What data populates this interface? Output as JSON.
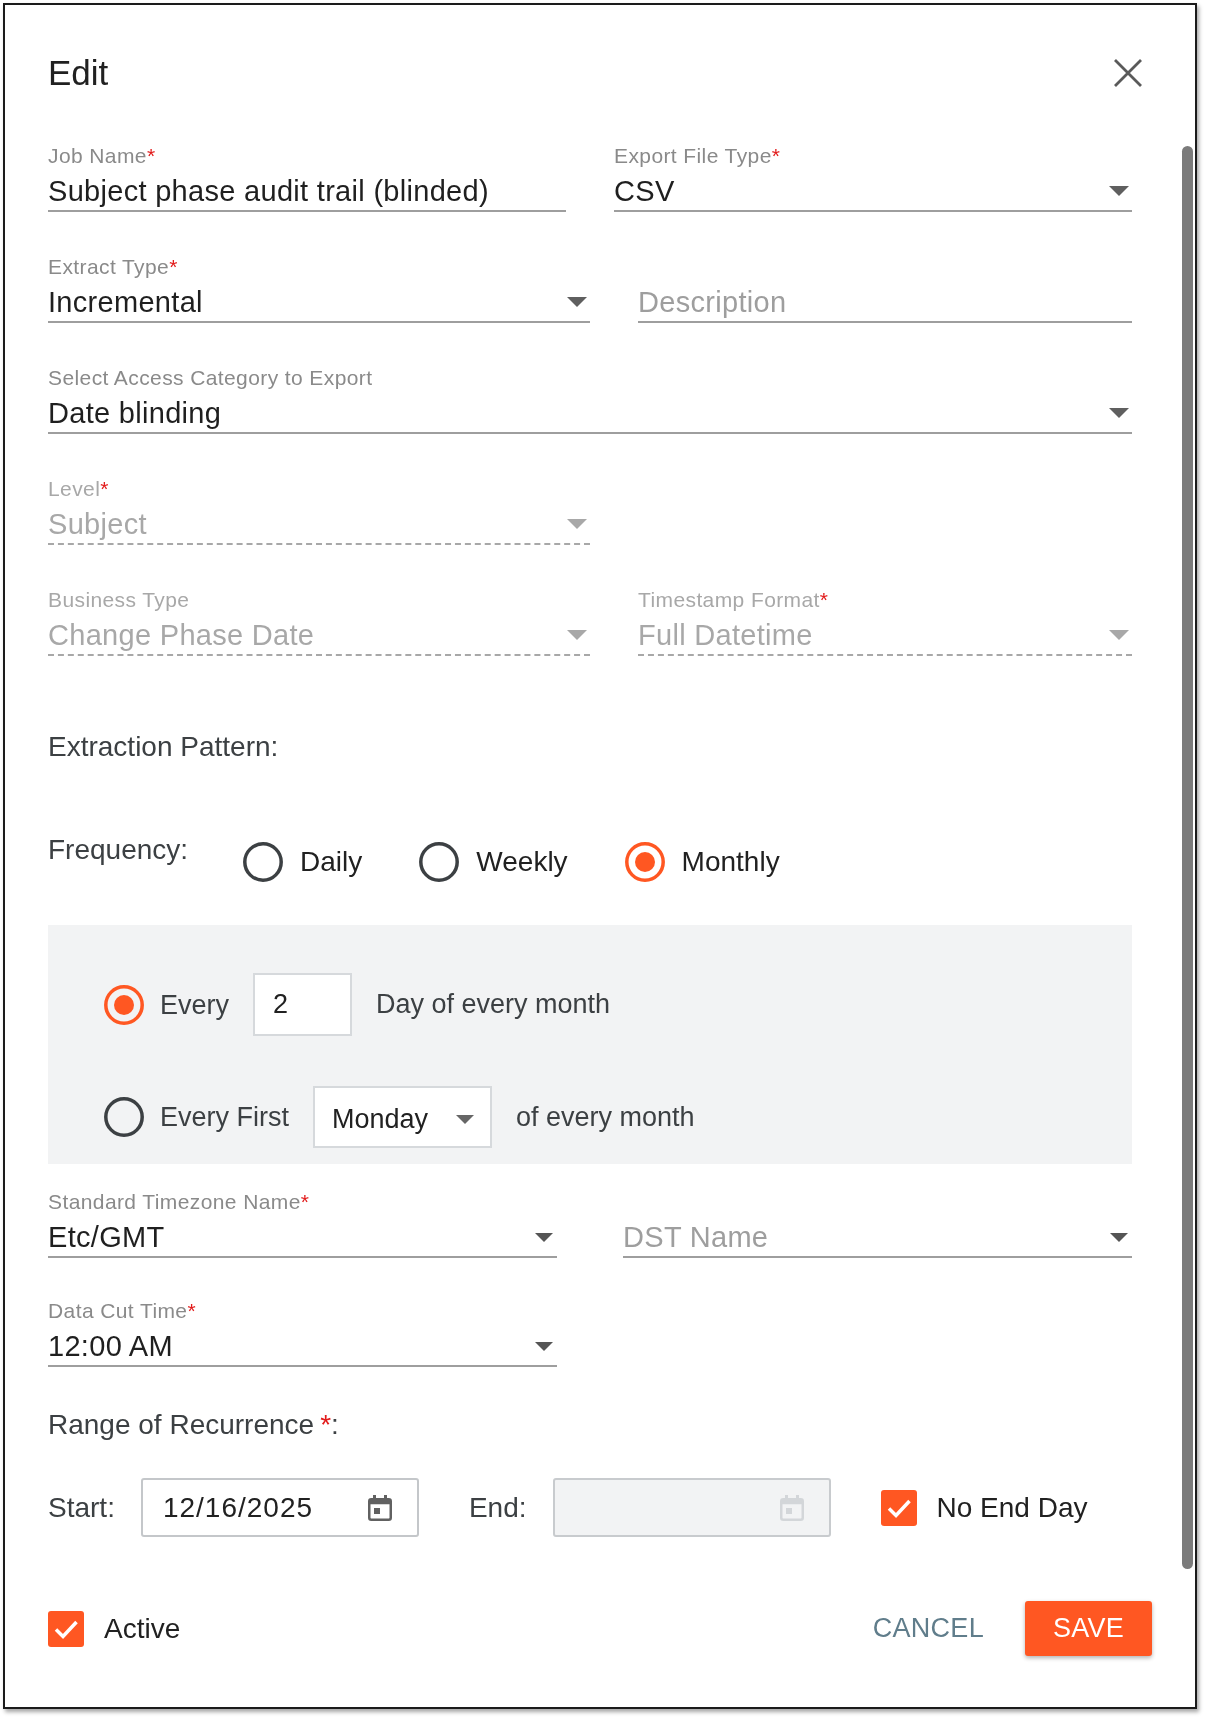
{
  "dialog": {
    "title": "Edit"
  },
  "field_rows": [
    [
      {
        "kind": "text",
        "label": "Job Name",
        "required_mark": "*",
        "value": "Subject phase audit trail (blinded)",
        "disabled": false
      },
      {
        "kind": "select",
        "label": "Export File Type",
        "required_mark": "*",
        "value": "CSV",
        "disabled": false
      }
    ],
    [
      {
        "kind": "select",
        "label": "Extract Type",
        "required_mark": "*",
        "value": "Incremental",
        "disabled": false
      },
      {
        "kind": "text",
        "placeholder": "Description",
        "disabled": false
      }
    ],
    [
      {
        "kind": "select",
        "label": "Select Access Category to Export",
        "value": "Date blinding",
        "disabled": false
      }
    ],
    [
      {
        "kind": "select",
        "label": "Level",
        "required_mark": "*",
        "value": "Subject",
        "disabled": true
      }
    ],
    [
      {
        "kind": "select",
        "label": "Business Type",
        "value": "Change Phase Date",
        "disabled": true
      },
      {
        "kind": "select",
        "label": "Timestamp Format",
        "required_mark": "*",
        "value": "Full Datetime",
        "disabled": true
      }
    ]
  ],
  "extraction_pattern": {
    "title": "Extraction Pattern:",
    "frequency_label": "Frequency:",
    "frequencies": [
      {
        "label": "Daily",
        "selected": false
      },
      {
        "label": "Weekly",
        "selected": false
      },
      {
        "label": "Monthly",
        "selected": true
      }
    ],
    "monthly_options": [
      {
        "kind": "day",
        "label": "Every",
        "value": "2",
        "suffix": "Day of every month",
        "selected": true
      },
      {
        "kind": "weekday",
        "label": "Every First",
        "value": "Monday",
        "suffix": "of every month",
        "selected": false
      }
    ]
  },
  "schedule_rows": [
    [
      {
        "kind": "select",
        "label": "Standard Timezone Name",
        "required_mark": "*",
        "value": "Etc/GMT",
        "disabled": false
      },
      {
        "kind": "select",
        "placeholder": "DST Name",
        "disabled": false
      }
    ],
    [
      {
        "kind": "select",
        "label": "Data Cut Time",
        "required_mark": "*",
        "value": "12:00 AM",
        "disabled": false
      }
    ]
  ],
  "range": {
    "title": "Range of Recurrence",
    "required_mark": "*",
    "suffix": ":",
    "dates": [
      {
        "label": "Start:",
        "value": "12/16/2025",
        "disabled": false
      },
      {
        "label": "End:",
        "disabled": true
      }
    ],
    "no_end_day": {
      "label": "No End Day",
      "checked": true
    }
  },
  "footer": {
    "active": {
      "label": "Active",
      "checked": true
    },
    "buttons": [
      {
        "kind": "text",
        "label": "CANCEL"
      },
      {
        "kind": "primary",
        "label": "SAVE"
      }
    ]
  }
}
